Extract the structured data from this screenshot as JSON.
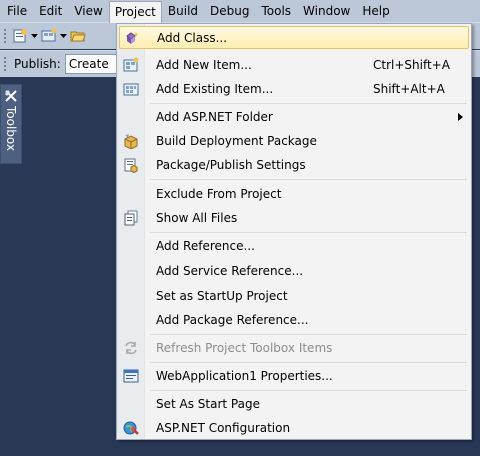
{
  "menubar": {
    "items": [
      "File",
      "Edit",
      "View",
      "Project",
      "Build",
      "Debug",
      "Tools",
      "Window",
      "Help"
    ],
    "open_item": "Project"
  },
  "toolbar2": {
    "publish_label": "Publish:",
    "publish_value": "Create"
  },
  "toolbox": {
    "label": "Toolbox"
  },
  "project_menu": {
    "items": [
      {
        "label": "Add Class...",
        "icon": "add-class-icon",
        "highlighted": true
      },
      {
        "label": "Add New Item...",
        "shortcut": "Ctrl+Shift+A",
        "icon": "new-item-icon"
      },
      {
        "label": "Add Existing Item...",
        "shortcut": "Shift+Alt+A",
        "icon": "existing-item-icon"
      },
      {
        "label": "Add ASP.NET Folder",
        "submenu": true
      },
      {
        "label": "Build Deployment Package",
        "icon": "package-icon"
      },
      {
        "label": "Package/Publish Settings",
        "icon": "publish-settings-icon"
      },
      {
        "label": "Exclude From Project"
      },
      {
        "label": "Show All Files",
        "icon": "show-all-files-icon"
      },
      {
        "label": "Add Reference..."
      },
      {
        "label": "Add Service Reference..."
      },
      {
        "label": "Set as StartUp Project"
      },
      {
        "label": "Add Package Reference..."
      },
      {
        "label": "Refresh Project Toolbox Items",
        "icon": "refresh-icon",
        "disabled": true
      },
      {
        "label": "WebApplication1 Properties...",
        "icon": "properties-icon"
      },
      {
        "label": "Set As Start Page"
      },
      {
        "label": "ASP.NET Configuration",
        "icon": "aspnet-config-icon"
      }
    ]
  },
  "colors": {
    "background": "#293955",
    "menubar": "#bcc7d8",
    "menu_background": "#f3f3f3",
    "highlight": "#ffeeb0",
    "disabled_text": "#8d8d8d"
  }
}
